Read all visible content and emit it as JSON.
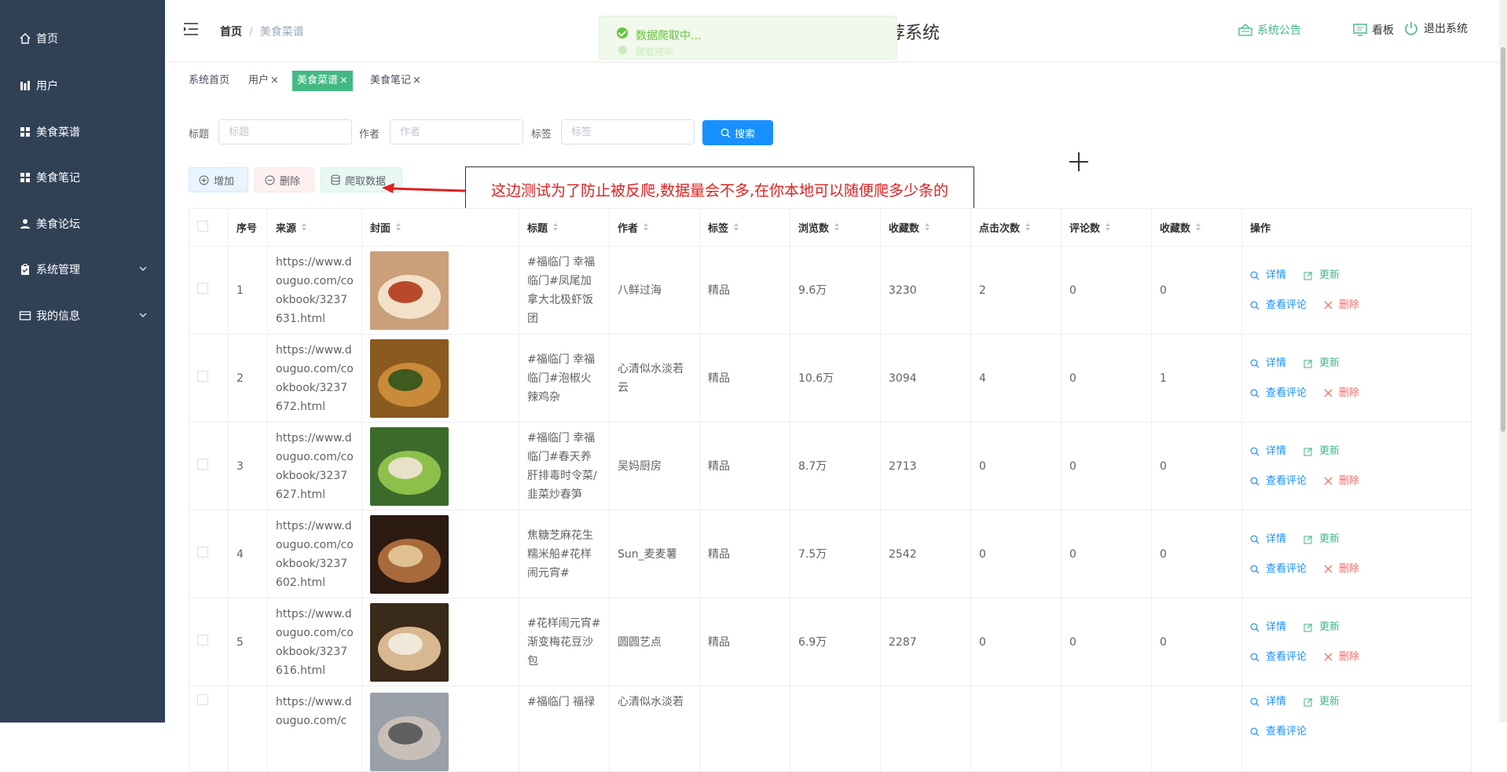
{
  "sidebar": {
    "items": [
      {
        "label": "首页",
        "icon": "home-icon"
      },
      {
        "label": "用户",
        "icon": "user-bars-icon"
      },
      {
        "label": "美食菜谱",
        "icon": "grid-icon"
      },
      {
        "label": "美食笔记",
        "icon": "grid-icon"
      },
      {
        "label": "美食论坛",
        "icon": "person-icon"
      },
      {
        "label": "系统管理",
        "icon": "clipboard-icon"
      },
      {
        "label": "我的信息",
        "icon": "card-icon"
      }
    ]
  },
  "header": {
    "breadcrumb_home": "首页",
    "breadcrumb_sep": "/",
    "breadcrumb_current": "美食菜谱",
    "title_visible": "荐系统",
    "notice": "系统公告",
    "board": "看板",
    "logout": "退出系统"
  },
  "toast": {
    "message": "数据爬取中...",
    "ghost": "爬取完毕"
  },
  "tags": [
    {
      "label": "系统首页"
    },
    {
      "label": "用户",
      "close": "×"
    },
    {
      "label": "美食菜谱",
      "close": "×"
    },
    {
      "label": "美食笔记",
      "close": "×"
    }
  ],
  "filters": {
    "title_label": "标题",
    "title_placeholder": "标题",
    "author_label": "作者",
    "author_placeholder": "作者",
    "tag_label": "标签",
    "tag_placeholder": "标签",
    "search": "搜索"
  },
  "actions": {
    "add": "增加",
    "delete": "删除",
    "crawl": "爬取数据"
  },
  "annotation": "这边测试为了防止被反爬,数据量会不多,在你本地可以随便爬多少条的",
  "table": {
    "headers": {
      "index": "序号",
      "source": "来源",
      "cover": "封面",
      "title": "标题",
      "author": "作者",
      "tag": "标签",
      "views": "浏览数",
      "favorites": "收藏数",
      "clicks": "点击次数",
      "comments": "评论数",
      "favorites2": "收藏数",
      "ops": "操作"
    },
    "ops": {
      "detail": "详情",
      "update": "更新",
      "view_comments": "查看评论",
      "remove": "删除"
    },
    "rows": [
      {
        "index": "1",
        "source": "https://www.douguo.com/cookbook/3237631.html",
        "title": "#福临门 幸福临门#凤尾加拿大北极虾饭团",
        "author": "八鲜过海",
        "tag": "精品",
        "views": "9.6万",
        "favorites": "3230",
        "clicks": "2",
        "comments": "0",
        "favorites2": "0"
      },
      {
        "index": "2",
        "source": "https://www.douguo.com/cookbook/3237672.html",
        "title": "#福临门 幸福临门#泡椒火辣鸡杂",
        "author": "心清似水淡若云",
        "tag": "精品",
        "views": "10.6万",
        "favorites": "3094",
        "clicks": "4",
        "comments": "0",
        "favorites2": "1"
      },
      {
        "index": "3",
        "source": "https://www.douguo.com/cookbook/3237627.html",
        "title": "#福临门 幸福临门#春天养肝排毒时令菜/韭菜炒春笋",
        "author": "吴妈厨房",
        "tag": "精品",
        "views": "8.7万",
        "favorites": "2713",
        "clicks": "0",
        "comments": "0",
        "favorites2": "0"
      },
      {
        "index": "4",
        "source": "https://www.douguo.com/cookbook/3237602.html",
        "title": "焦糖芝麻花生糯米船#花样闹元宵#",
        "author": "Sun_麦麦薯",
        "tag": "精品",
        "views": "7.5万",
        "favorites": "2542",
        "clicks": "0",
        "comments": "0",
        "favorites2": "0"
      },
      {
        "index": "5",
        "source": "https://www.douguo.com/cookbook/3237616.html",
        "title": "#花样闹元宵#渐变梅花豆沙包",
        "author": "圆圆艺点",
        "tag": "精品",
        "views": "6.9万",
        "favorites": "2287",
        "clicks": "0",
        "comments": "0",
        "favorites2": "0"
      },
      {
        "index": "",
        "source": "https://www.douguo.com/c",
        "title": "#福临门 福禄",
        "author": "心清似水淡若",
        "tag": "",
        "views": "",
        "favorites": "",
        "clicks": "",
        "comments": "",
        "favorites2": ""
      }
    ]
  },
  "colors": {
    "sidebar_bg": "#304156",
    "active_tag": "#42b983",
    "primary": "#1890ff",
    "danger": "#f56c6c",
    "success": "#67c23a",
    "annotation_text": "#e02020"
  }
}
